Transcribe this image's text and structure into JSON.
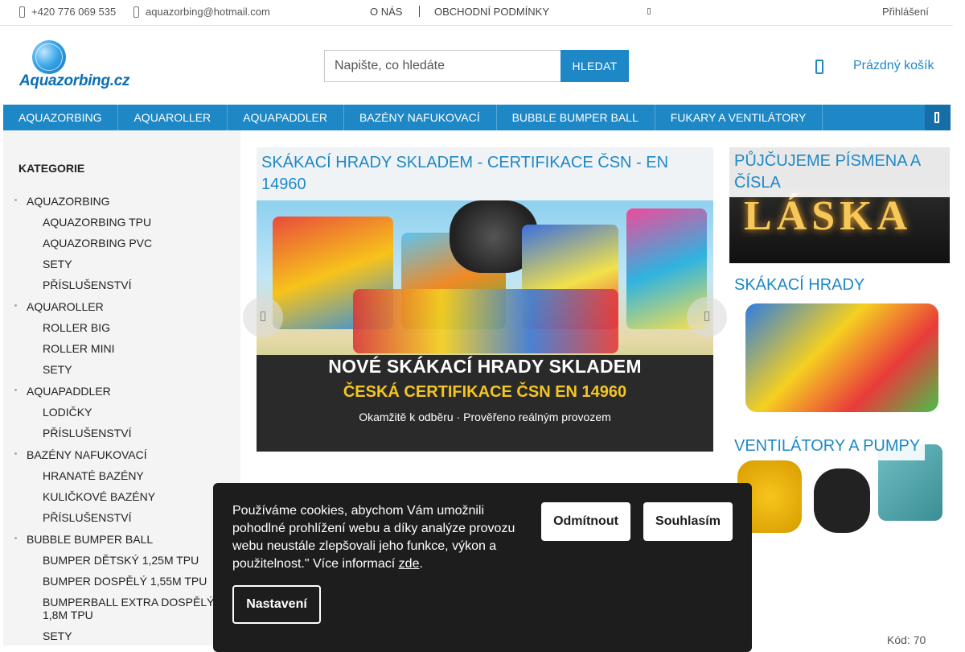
{
  "topbar": {
    "phone": "+420 776 069 535",
    "email": "aquazorbing@hotmail.com",
    "nav": [
      "O NÁS",
      "OBCHODNÍ PODMÍNKY"
    ],
    "login": "Přihlášení"
  },
  "logo": {
    "text": "Aquazorbing.cz"
  },
  "search": {
    "placeholder": "Napište, co hledáte",
    "button": "HLEDAT"
  },
  "cart": {
    "label": "Prázdný košík"
  },
  "mainnav": {
    "items": [
      "AQUAZORBING",
      "AQUAROLLER",
      "AQUAPADDLER",
      "BAZÉNY NAFUKOVACÍ",
      "BUBBLE BUMPER BALL",
      "FUKARY A VENTILÁTORY"
    ]
  },
  "sidebar": {
    "title": "KATEGORIE",
    "items": [
      {
        "label": "AQUAZORBING",
        "level": 1
      },
      {
        "label": "AQUAZORBING TPU",
        "level": 2
      },
      {
        "label": "AQUAZORBING PVC",
        "level": 2
      },
      {
        "label": "SETY",
        "level": 2
      },
      {
        "label": "PŘÍSLUŠENSTVÍ",
        "level": 2
      },
      {
        "label": "AQUAROLLER",
        "level": 1
      },
      {
        "label": "ROLLER BIG",
        "level": 2
      },
      {
        "label": "ROLLER MINI",
        "level": 2
      },
      {
        "label": "SETY",
        "level": 2
      },
      {
        "label": "AQUAPADDLER",
        "level": 1
      },
      {
        "label": "LODIČKY",
        "level": 2
      },
      {
        "label": "PŘÍSLUŠENSTVÍ",
        "level": 2
      },
      {
        "label": "BAZÉNY NAFUKOVACÍ",
        "level": 1
      },
      {
        "label": "HRANATÉ BAZÉNY",
        "level": 2
      },
      {
        "label": "KULIČKOVÉ BAZÉNY",
        "level": 2
      },
      {
        "label": "PŘÍSLUŠENSTVÍ",
        "level": 2
      },
      {
        "label": "BUBBLE BUMPER BALL",
        "level": 1
      },
      {
        "label": "BUMPER DĚTSKÝ 1,25M TPU",
        "level": 2
      },
      {
        "label": "BUMPER DOSPĚLÝ 1,55M TPU",
        "level": 2
      },
      {
        "label": "BUMPERBALL EXTRA DOSPĚLÝ 1,8M TPU",
        "level": 2
      },
      {
        "label": "SETY",
        "level": 2
      }
    ]
  },
  "hero": {
    "caption": "SKÁKACÍ HRADY SKLADEM - CERTIFIKACE ČSN - EN 14960",
    "banner_line1": "NOVÉ SKÁKACÍ HRADY SKLADEM",
    "banner_line2": "ČESKÁ CERTIFIKACE ČSN EN 14960",
    "banner_line3": "Okamžitě k odběru · Prověřeno reálným provozem"
  },
  "promos": [
    {
      "label": "PŮJČUJEME PÍSMENA A ČÍSLA",
      "image_text": "LÁSKA"
    },
    {
      "label": "SKÁKACÍ HRADY"
    },
    {
      "label": "VENTILÁTORY A PUMPY"
    }
  ],
  "cookie": {
    "text": "Používáme cookies, abychom Vám umožnili pohodlné prohlížení webu a díky analýze provozu webu neustále zlepšovali jeho funkce, výkon a použitelnost.\" Více informací ",
    "link": "zde",
    "link_after": ".",
    "reject": "Odmítnout",
    "accept": "Souhlasím",
    "settings": "Nastavení"
  },
  "product_code": "Kód: 70",
  "colors": {
    "accent": "#1e88c7",
    "nav_dark": "#156ea5",
    "cookie_bg": "#1d1d1d",
    "sidebar_bg": "#f4f4f4"
  }
}
